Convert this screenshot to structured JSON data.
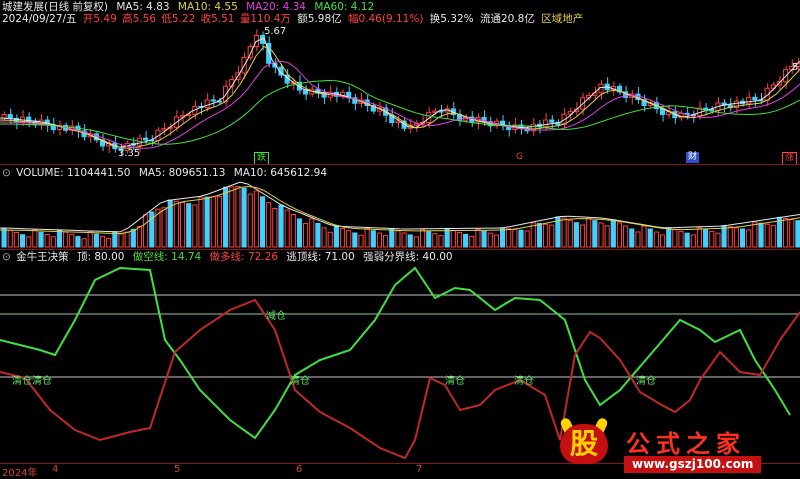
{
  "stock": {
    "name": "城建发展(日线 前复权)"
  },
  "price_panel": {
    "ma_labels": [
      {
        "text": "MA5: 4.83",
        "color": "#e8e8e8"
      },
      {
        "text": "MA10: 4.55",
        "color": "#e0d040"
      },
      {
        "text": "MA20: 4.34",
        "color": "#e040e0"
      },
      {
        "text": "MA60: 4.12",
        "color": "#40e040"
      }
    ],
    "ohlc": {
      "date": "2024/09/27/五",
      "open": "开5.49",
      "high": "高5.56",
      "low": "低5.22",
      "close": "收5.51",
      "volume": "量110.4万",
      "amount": "额5.98亿",
      "change": "幅0.46(9.11%)",
      "turnover": "换5.32%",
      "float": "流通20.8亿",
      "sector": "区域地产"
    },
    "annotations": {
      "high": "5.67",
      "low": "3.35"
    },
    "edge_value": "5.",
    "markers": [
      {
        "text": "跌",
        "color": "#40e040"
      },
      {
        "text": "G",
        "color": "#ff4040"
      },
      {
        "text": "财",
        "color": "#6090ff"
      },
      {
        "text": "涨",
        "color": "#ff4040"
      }
    ]
  },
  "volume_panel": {
    "labels": [
      {
        "text": "VOLUME: 1104441.50",
        "color": "#e8e8e8"
      },
      {
        "text": "MA5: 809651.13",
        "color": "#e8e8e8"
      },
      {
        "text": "MA10: 645612.94",
        "color": "#e8e8e8"
      }
    ]
  },
  "indicator_panel": {
    "labels": [
      {
        "text": "金牛王决策",
        "color": "#e8e8e8"
      },
      {
        "text": "顶: 80.00",
        "color": "#e8e8e8"
      },
      {
        "text": "做空线: 14.74",
        "color": "#40e040"
      },
      {
        "text": "做多线: 72.26",
        "color": "#ff4040"
      },
      {
        "text": "逃顶线: 71.00",
        "color": "#e8e8e8"
      },
      {
        "text": "强弱分界线: 40.00",
        "color": "#e8e8e8"
      }
    ],
    "signals": [
      "减仓",
      "清仓清仓",
      "清仓",
      "清仓",
      "清仓",
      "清仓"
    ]
  },
  "x_axis": [
    "2024年",
    "4",
    "5",
    "6",
    "7"
  ],
  "watermark": {
    "glyph": "股",
    "title": "公式之家",
    "url": "www.gszj100.com"
  },
  "colors": {
    "up": "#ff4040",
    "down": "#40d0ff",
    "ma5": "#e8e8e8",
    "ma10": "#e0d040",
    "ma20": "#e040e0",
    "ma60": "#40e040",
    "bear_line": "#40e040",
    "bull_line": "#c0282a",
    "level": "#9ac49a"
  }
}
